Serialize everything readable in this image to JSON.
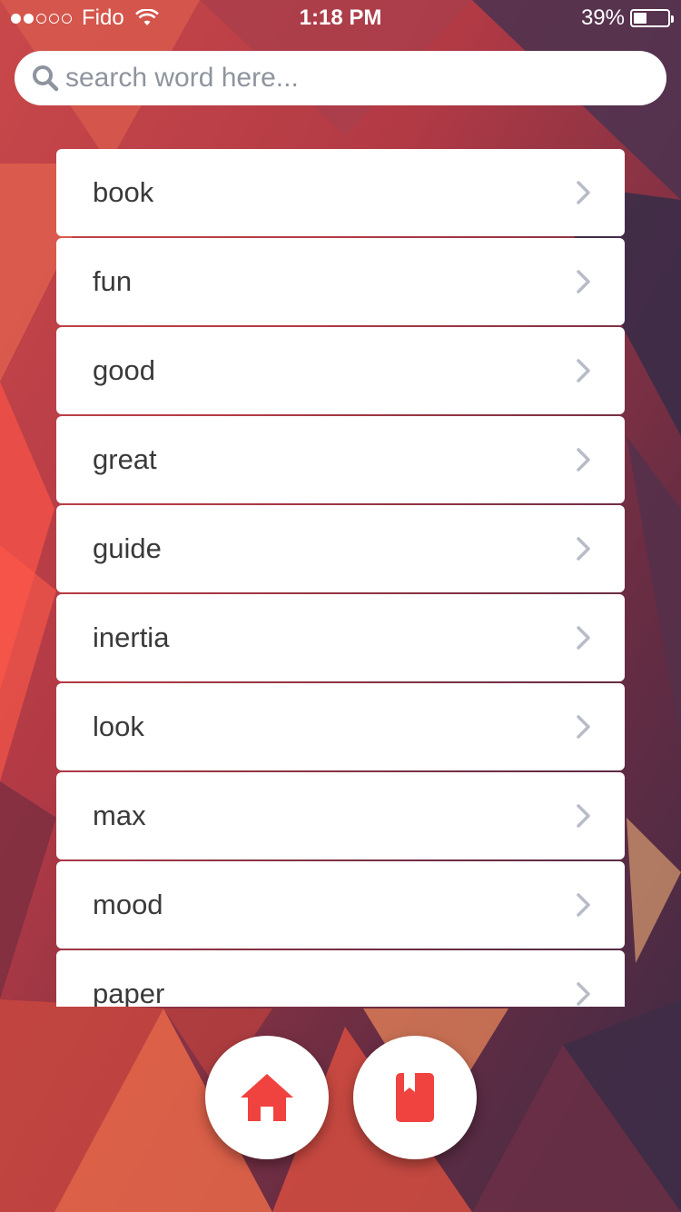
{
  "status_bar": {
    "signal_dots_filled": 2,
    "signal_dots_total": 5,
    "carrier": "Fido",
    "time": "1:18 PM",
    "battery_percent_text": "39%",
    "battery_level": 0.39
  },
  "search": {
    "placeholder": "search word here...",
    "value": ""
  },
  "words": [
    {
      "label": "book"
    },
    {
      "label": "fun"
    },
    {
      "label": "good"
    },
    {
      "label": "great"
    },
    {
      "label": "guide"
    },
    {
      "label": "inertia"
    },
    {
      "label": "look"
    },
    {
      "label": "max"
    },
    {
      "label": "mood"
    },
    {
      "label": "paper"
    }
  ],
  "bottom_nav": {
    "home_icon": "home-icon",
    "book_icon": "bookmark-book-icon"
  },
  "colors": {
    "accent": "#f0433f",
    "chevron": "#b7bcc6",
    "text": "#3a3a3a",
    "placeholder": "#8e949e"
  }
}
